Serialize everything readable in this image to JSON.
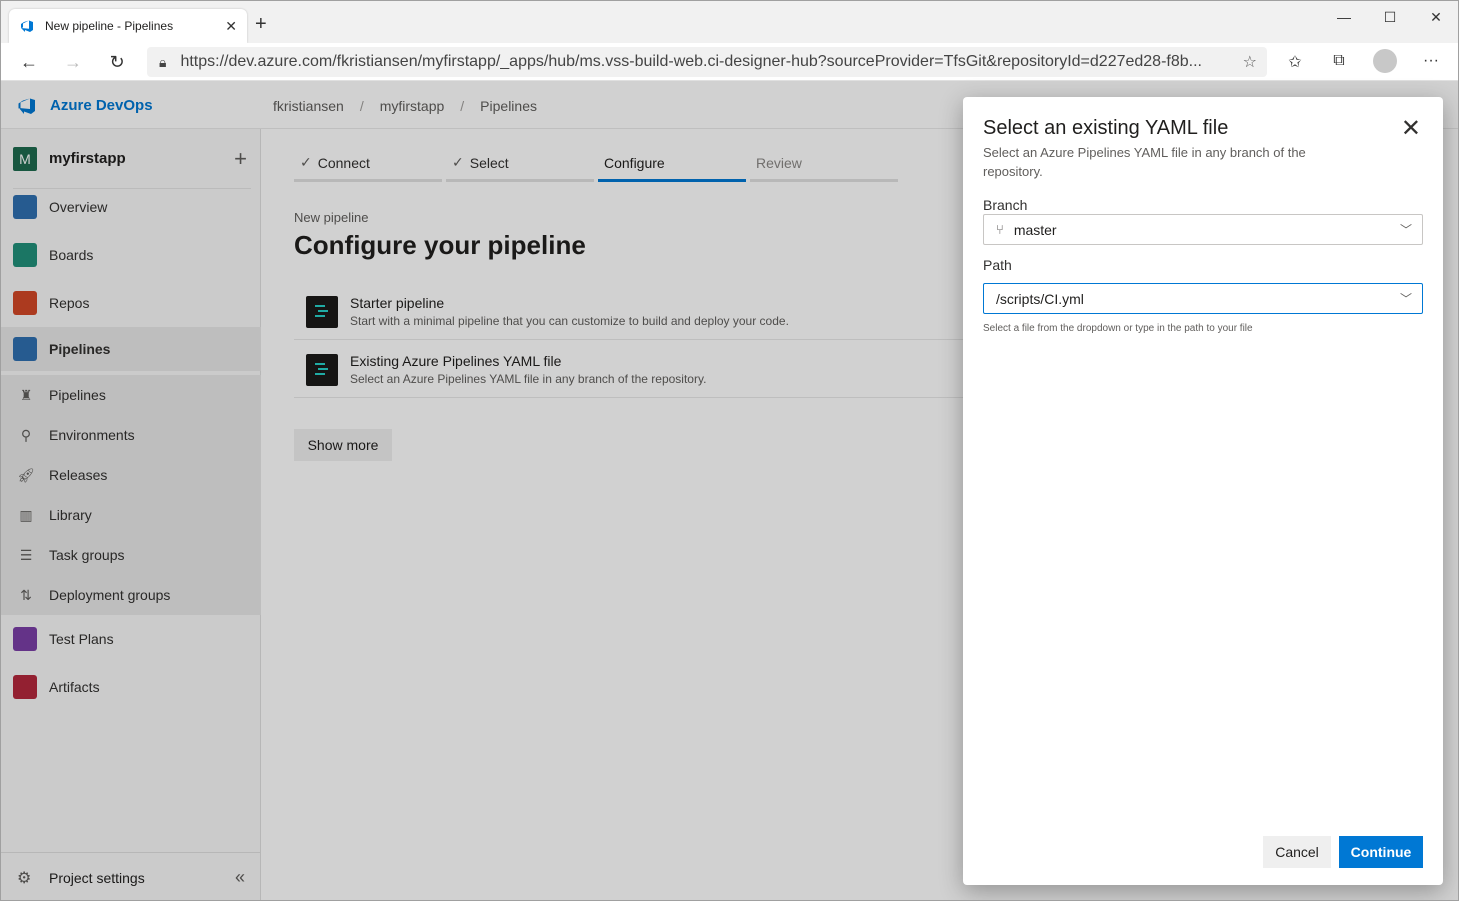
{
  "browser": {
    "tab_title": "New pipeline - Pipelines",
    "url": "https://dev.azure.com/fkristiansen/myfirstapp/_apps/hub/ms.vss-build-web.ci-designer-hub?sourceProvider=TfsGit&repositoryId=d227ed28-f8b..."
  },
  "header": {
    "brand": "Azure DevOps",
    "breadcrumb": [
      "fkristiansen",
      "myfirstapp",
      "Pipelines"
    ],
    "breadcrumb_sep": "/"
  },
  "sidebar": {
    "project_initial": "M",
    "project_name": "myfirstapp",
    "items": [
      {
        "label": "Overview",
        "color": "#2f6fb0"
      },
      {
        "label": "Boards",
        "color": "#21907a"
      },
      {
        "label": "Repos",
        "color": "#d24726"
      },
      {
        "label": "Pipelines",
        "color": "#2f6fb0"
      },
      {
        "label": "Test Plans",
        "color": "#7b3fa6"
      },
      {
        "label": "Artifacts",
        "color": "#b4283c"
      }
    ],
    "sub_items": [
      "Pipelines",
      "Environments",
      "Releases",
      "Library",
      "Task groups",
      "Deployment groups"
    ],
    "footer_label": "Project settings"
  },
  "main": {
    "steps": [
      "Connect",
      "Select",
      "Configure",
      "Review"
    ],
    "kicker": "New pipeline",
    "title": "Configure your pipeline",
    "options": [
      {
        "title": "Starter pipeline",
        "desc": "Start with a minimal pipeline that you can customize to build and deploy your code."
      },
      {
        "title": "Existing Azure Pipelines YAML file",
        "desc": "Select an Azure Pipelines YAML file in any branch of the repository."
      }
    ],
    "show_more": "Show more"
  },
  "dialog": {
    "title": "Select an existing YAML file",
    "subtitle": "Select an Azure Pipelines YAML file in any branch of the repository.",
    "branch_label": "Branch",
    "branch_value": "master",
    "path_label": "Path",
    "path_value": "/scripts/CI.yml",
    "hint": "Select a file from the dropdown or type in the path to your file",
    "cancel": "Cancel",
    "continue": "Continue"
  },
  "colors": {
    "accent": "#0078d4"
  }
}
